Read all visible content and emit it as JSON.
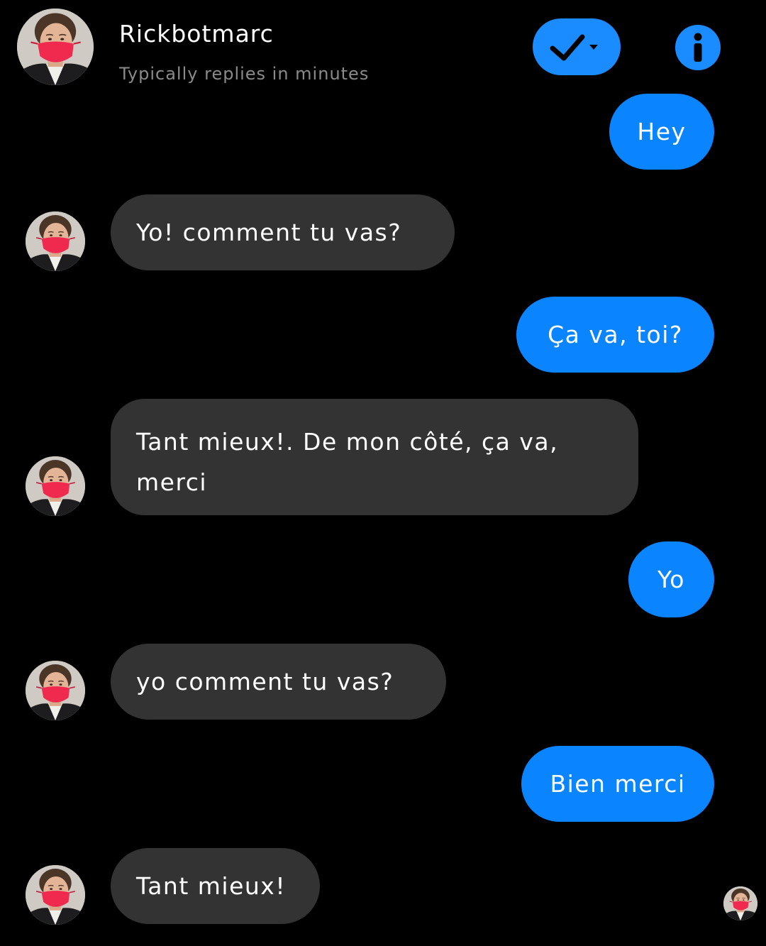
{
  "header": {
    "name": "Rickbotmarc",
    "status": "Typically replies in minutes",
    "avatar_icon": "avatar-photo",
    "status_button_icon": "check-dropdown-icon",
    "info_button_icon": "info-icon"
  },
  "colors": {
    "background": "#000000",
    "outgoing_bubble": "#0a84ff",
    "incoming_bubble": "#333333",
    "accent": "#1a8cff",
    "status_text": "#8a8a8a"
  },
  "messages": [
    {
      "direction": "out",
      "text": "Hey"
    },
    {
      "direction": "in",
      "text": "Yo! comment tu vas?"
    },
    {
      "direction": "out",
      "text": "Ça va, toi?"
    },
    {
      "direction": "in",
      "text": "Tant mieux!. De mon côté, ça va, merci"
    },
    {
      "direction": "out",
      "text": "Yo"
    },
    {
      "direction": "in",
      "text": "yo comment tu vas?"
    },
    {
      "direction": "out",
      "text": "Bien merci"
    },
    {
      "direction": "in",
      "text": "Tant mieux!"
    }
  ]
}
